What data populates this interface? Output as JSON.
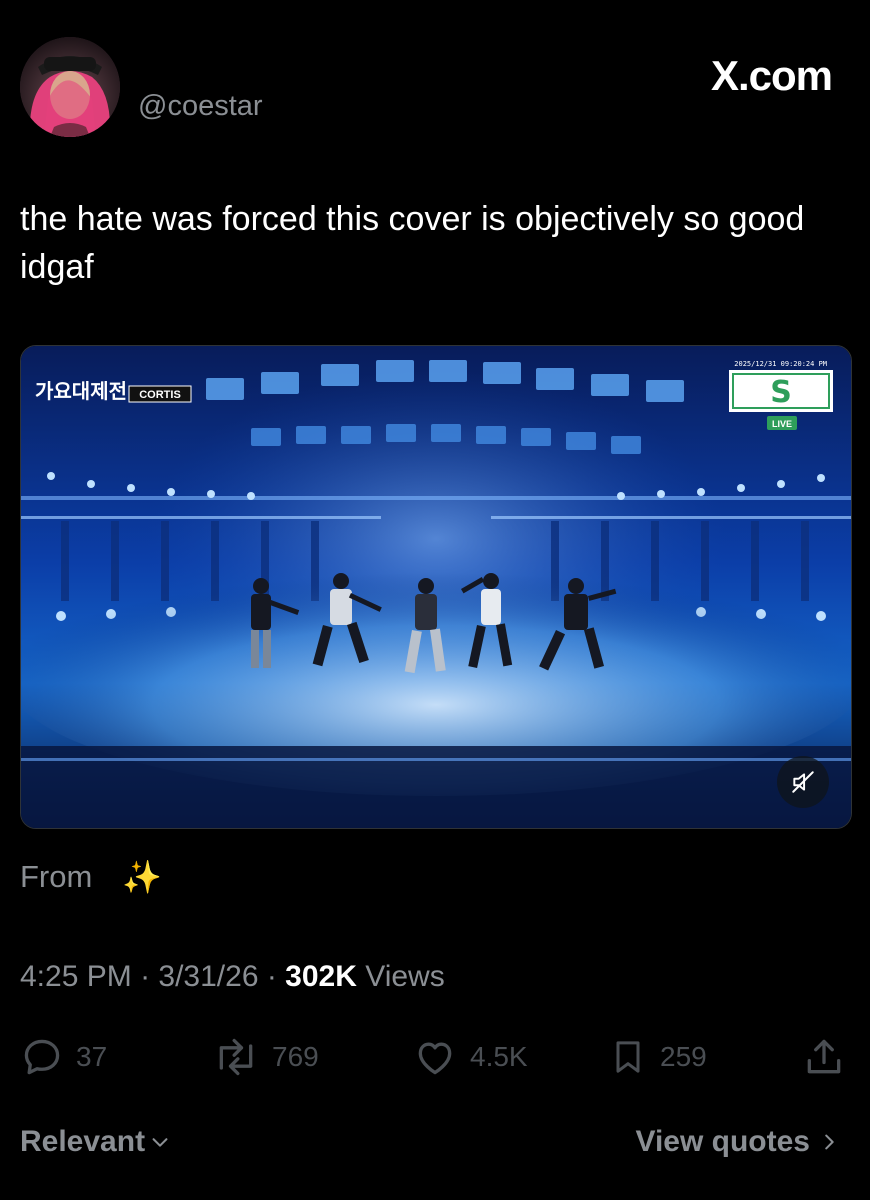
{
  "tweet": {
    "handle": "@coestar",
    "brand": "X.com",
    "text": "the hate was forced this cover is objectively so good idgaf",
    "from_label": "From",
    "from_emoji": "✨",
    "time": "4:25 PM",
    "date": "3/31/26",
    "views_count": "302K",
    "views_label": "Views"
  },
  "media": {
    "timestamp": "2025/12/31 09:20:24 PM",
    "logo_text": "가요대제전",
    "artist_tag": "CORTIS",
    "live_badge": "LIVE",
    "muted": true
  },
  "actions": {
    "replies": "37",
    "reposts": "769",
    "likes": "4.5K",
    "bookmarks": "259"
  },
  "footer": {
    "sort_label": "Relevant",
    "quotes_label": "View quotes"
  },
  "icons": [
    "avatar",
    "reply-icon",
    "repost-icon",
    "like-icon",
    "bookmark-icon",
    "share-icon",
    "mute-icon",
    "chevron-down-icon",
    "chevron-right-icon"
  ]
}
